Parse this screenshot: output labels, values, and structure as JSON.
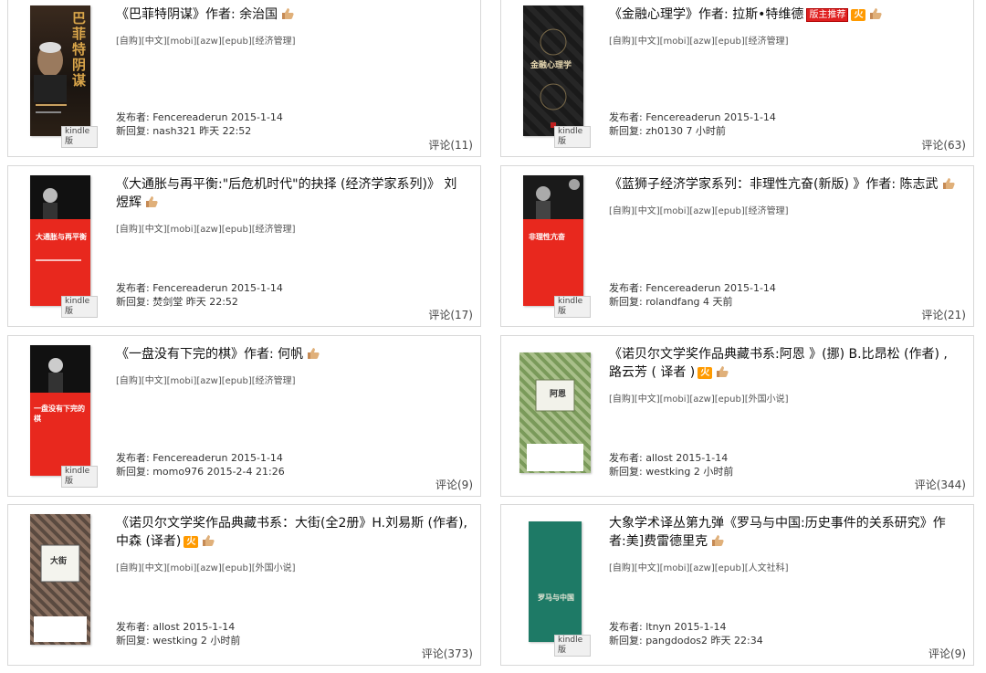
{
  "cards": [
    {
      "title": "《巴菲特阴谋》作者: 余治国",
      "tags": "[自购][中文][mobi][azw][epub][经济管理]",
      "poster": "发布者: Fencereaderun 2015-1-14",
      "reply": "新回复: nash321 昨天 22:52",
      "comments": "评论(11)",
      "kindle": "kindle版",
      "cover_text": "巴菲特阴谋"
    },
    {
      "title": "《金融心理学》作者: 拉斯•特维德",
      "badge_rec": "版主推荐",
      "badge_hot": "火",
      "tags": "[自购][中文][mobi][azw][epub][经济管理]",
      "poster": "发布者: Fencereaderun 2015-1-14",
      "reply": "新回复: zh0130 7 小时前",
      "comments": "评论(63)",
      "kindle": "kindle版",
      "cover_text": "金融心理学"
    },
    {
      "title": "《大通胀与再平衡:\"后危机时代\"的抉择 (经济学家系列)》 刘煜辉",
      "tags": "[自购][中文][mobi][azw][epub][经济管理]",
      "poster": "发布者: Fencereaderun 2015-1-14",
      "reply": "新回复: 焚剑堂 昨天 22:52",
      "comments": "评论(17)",
      "kindle": "kindle版",
      "cover_text": "大通胀与再平衡"
    },
    {
      "title": "《蓝狮子经济学家系列：非理性亢奋(新版) 》作者: 陈志武",
      "tags": "[自购][中文][mobi][azw][epub][经济管理]",
      "poster": "发布者: Fencereaderun 2015-1-14",
      "reply": "新回复: rolandfang 4 天前",
      "comments": "评论(21)",
      "kindle": "kindle版",
      "cover_text": "非理性亢奋"
    },
    {
      "title": "《一盘没有下完的棋》作者: 何帆",
      "tags": "[自购][中文][mobi][azw][epub][经济管理]",
      "poster": "发布者: Fencereaderun 2015-1-14",
      "reply": "新回复: momo976 2015-2-4 21:26",
      "comments": "评论(9)",
      "kindle": "kindle版",
      "cover_text": "一盘没有下完的棋"
    },
    {
      "title": "《诺贝尔文学奖作品典藏书系:阿恩 》(挪) B.比昂松 (作者) , 路云芳 ( 译者 )",
      "badge_hot": "火",
      "tags": "[自购][中文][mobi][azw][epub][外国小说]",
      "poster": "发布者: allost 2015-1-14",
      "reply": "新回复: westking 2 小时前",
      "comments": "评论(344)",
      "cover_text": "阿恩"
    },
    {
      "title": "《诺贝尔文学奖作品典藏书系：大街(全2册》H.刘易斯 (作者), 中森 (译者)",
      "badge_hot": "火",
      "tags": "[自购][中文][mobi][azw][epub][外国小说]",
      "poster": "发布者: allost 2015-1-14",
      "reply": "新回复: westking 2 小时前",
      "comments": "评论(373)",
      "cover_text": "大街"
    },
    {
      "title": "大象学术译丛第九弹《罗马与中国:历史事件的关系研究》作者:美]费雷德里克",
      "tags": "[自购][中文][mobi][azw][epub][人文社科]",
      "poster": "发布者: ltnyn 2015-1-14",
      "reply": "新回复: pangdodos2 昨天 22:34",
      "comments": "评论(9)",
      "kindle": "kindle版",
      "cover_text": "罗马与中国"
    }
  ],
  "colors": {
    "cover_red": "#e8281e",
    "cover_dark": "#1c1c1c",
    "cover_green": "#1e7a66",
    "badge_red": "#e02020",
    "badge_orange": "#ff9a00"
  }
}
